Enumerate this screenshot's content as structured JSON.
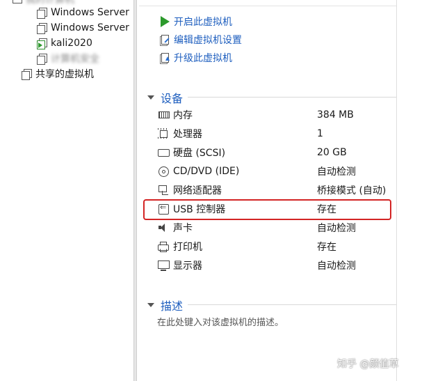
{
  "tree": {
    "my_computer_label": "我的计算机",
    "items": [
      {
        "label": "Windows Server"
      },
      {
        "label": "Windows Server"
      },
      {
        "label": "kali2020"
      },
      {
        "label": "计算机安全"
      }
    ],
    "shared_vms_label": "共享的虚拟机"
  },
  "actions": {
    "power_on": "开启此虚拟机",
    "edit_settings": "编辑虚拟机设置",
    "upgrade": "升级此虚拟机"
  },
  "devices": {
    "section_title": "设备",
    "rows": [
      {
        "name": "内存",
        "value": "384 MB",
        "icon": "memory-icon"
      },
      {
        "name": "处理器",
        "value": "1",
        "icon": "cpu-icon"
      },
      {
        "name": "硬盘 (SCSI)",
        "value": "20 GB",
        "icon": "hard-disk-icon"
      },
      {
        "name": "CD/DVD (IDE)",
        "value": "自动检测",
        "icon": "cd-dvd-icon"
      },
      {
        "name": "网络适配器",
        "value": "桥接模式 (自动)",
        "icon": "network-adapter-icon"
      },
      {
        "name": "USB 控制器",
        "value": "存在",
        "icon": "usb-icon"
      },
      {
        "name": "声卡",
        "value": "自动检测",
        "icon": "speaker-icon"
      },
      {
        "name": "打印机",
        "value": "存在",
        "icon": "printer-icon"
      },
      {
        "name": "显示器",
        "value": "自动检测",
        "icon": "monitor-icon"
      }
    ]
  },
  "description": {
    "section_title": "描述",
    "placeholder": "在此处键入对该虚拟机的描述。"
  },
  "watermark": "知乎 @颜值草",
  "colors": {
    "link_blue": "#1f5fbf",
    "highlight_red": "#d32424",
    "play_green": "#2c9a2c"
  }
}
